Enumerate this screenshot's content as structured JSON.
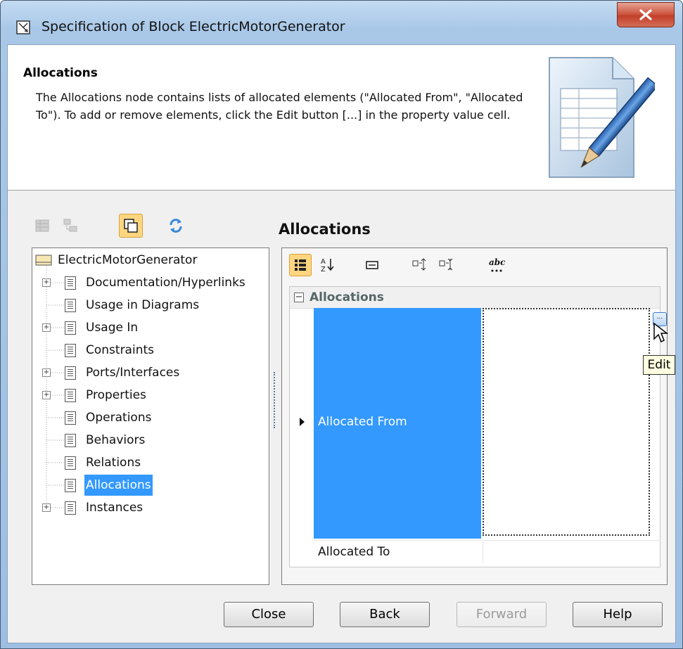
{
  "window": {
    "title": "Specification of Block ElectricMotorGenerator",
    "close_label": "Close window"
  },
  "header": {
    "title": "Allocations",
    "description": "The Allocations node contains lists of allocated elements (\"Allocated From\", \"Allocated To\"). To add or remove elements, click the Edit button [...] in the property value cell."
  },
  "left_toolbar": {
    "icons": [
      "table-view-icon",
      "tree-view-icon",
      "copy-icon",
      "refresh-icon"
    ],
    "active": "copy-icon"
  },
  "tree": {
    "root": "ElectricMotorGenerator",
    "items": [
      {
        "label": "Documentation/Hyperlinks",
        "expandable": true
      },
      {
        "label": "Usage in Diagrams",
        "expandable": false
      },
      {
        "label": "Usage In",
        "expandable": true
      },
      {
        "label": "Constraints",
        "expandable": false
      },
      {
        "label": "Ports/Interfaces",
        "expandable": true
      },
      {
        "label": "Properties",
        "expandable": true
      },
      {
        "label": "Operations",
        "expandable": false
      },
      {
        "label": "Behaviors",
        "expandable": false
      },
      {
        "label": "Relations",
        "expandable": false
      },
      {
        "label": "Allocations",
        "expandable": false,
        "selected": true
      },
      {
        "label": "Instances",
        "expandable": true
      }
    ]
  },
  "panel": {
    "title": "Allocations",
    "toolbar": {
      "abc_label": "abc"
    },
    "group": "Allocations",
    "rows": [
      {
        "name": "Allocated From",
        "value": "",
        "selected": true
      },
      {
        "name": "Allocated To",
        "value": ""
      }
    ],
    "edit_button_label": "...",
    "tooltip": "Edit"
  },
  "buttons": {
    "close": "Close",
    "back": "Back",
    "forward": "Forward",
    "help": "Help"
  },
  "colors": {
    "selection": "#3399ff",
    "tooltip_bg": "#ffffe1",
    "active_toggle": "#ffd580"
  }
}
